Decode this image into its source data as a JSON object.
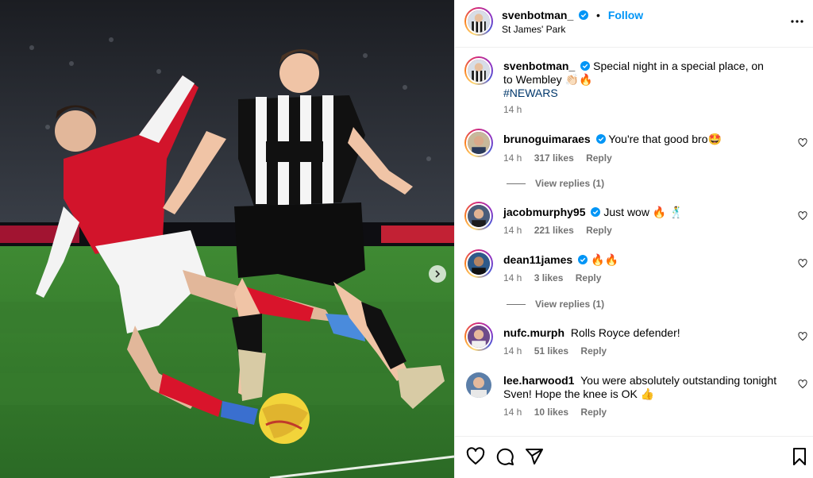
{
  "post": {
    "username": "svenbotman_",
    "follow_label": "Follow",
    "dot": "•",
    "location": "St James' Park",
    "caption": "Special night in a special place, on to Wembley 👏🏻🔥",
    "hashtag": "#NEWARS",
    "time": "14 h"
  },
  "comments": [
    {
      "username": "brunoguimaraes",
      "verified": true,
      "text": "You're that good bro🤩",
      "time": "14 h",
      "likes": "317 likes",
      "reply": "Reply",
      "view_replies": "View replies (1)",
      "avatar_color": "#c7b89a"
    },
    {
      "username": "jacobmurphy95",
      "verified": true,
      "text": "Just wow 🔥 🕺",
      "time": "14 h",
      "likes": "221 likes",
      "reply": "Reply",
      "view_replies": "",
      "avatar_color": "#4a5d7a"
    },
    {
      "username": "dean11james",
      "verified": true,
      "text": "🔥🔥",
      "time": "14 h",
      "likes": "3 likes",
      "reply": "Reply",
      "view_replies": "View replies (1)",
      "avatar_color": "#2e5a8a"
    },
    {
      "username": "nufc.murph",
      "verified": false,
      "text": "Rolls Royce defender!",
      "time": "14 h",
      "likes": "51 likes",
      "reply": "Reply",
      "view_replies": "",
      "avatar_color": "#6d4a8a"
    },
    {
      "username": "lee.harwood1",
      "verified": false,
      "text": "You were absolutely outstanding tonight Sven! Hope the knee is OK 👍",
      "time": "14 h",
      "likes": "10 likes",
      "reply": "Reply",
      "view_replies": "",
      "avatar_color": "#5b7ea8"
    }
  ],
  "icons": {
    "verified": "verified-badge-icon",
    "more": "more-options-icon",
    "like": "heart-icon",
    "comment": "comment-icon",
    "share": "share-icon",
    "save": "bookmark-icon",
    "next": "chevron-right-icon"
  },
  "colors": {
    "accent": "#0095f6",
    "hashtag": "#00376b",
    "muted": "#737373"
  }
}
